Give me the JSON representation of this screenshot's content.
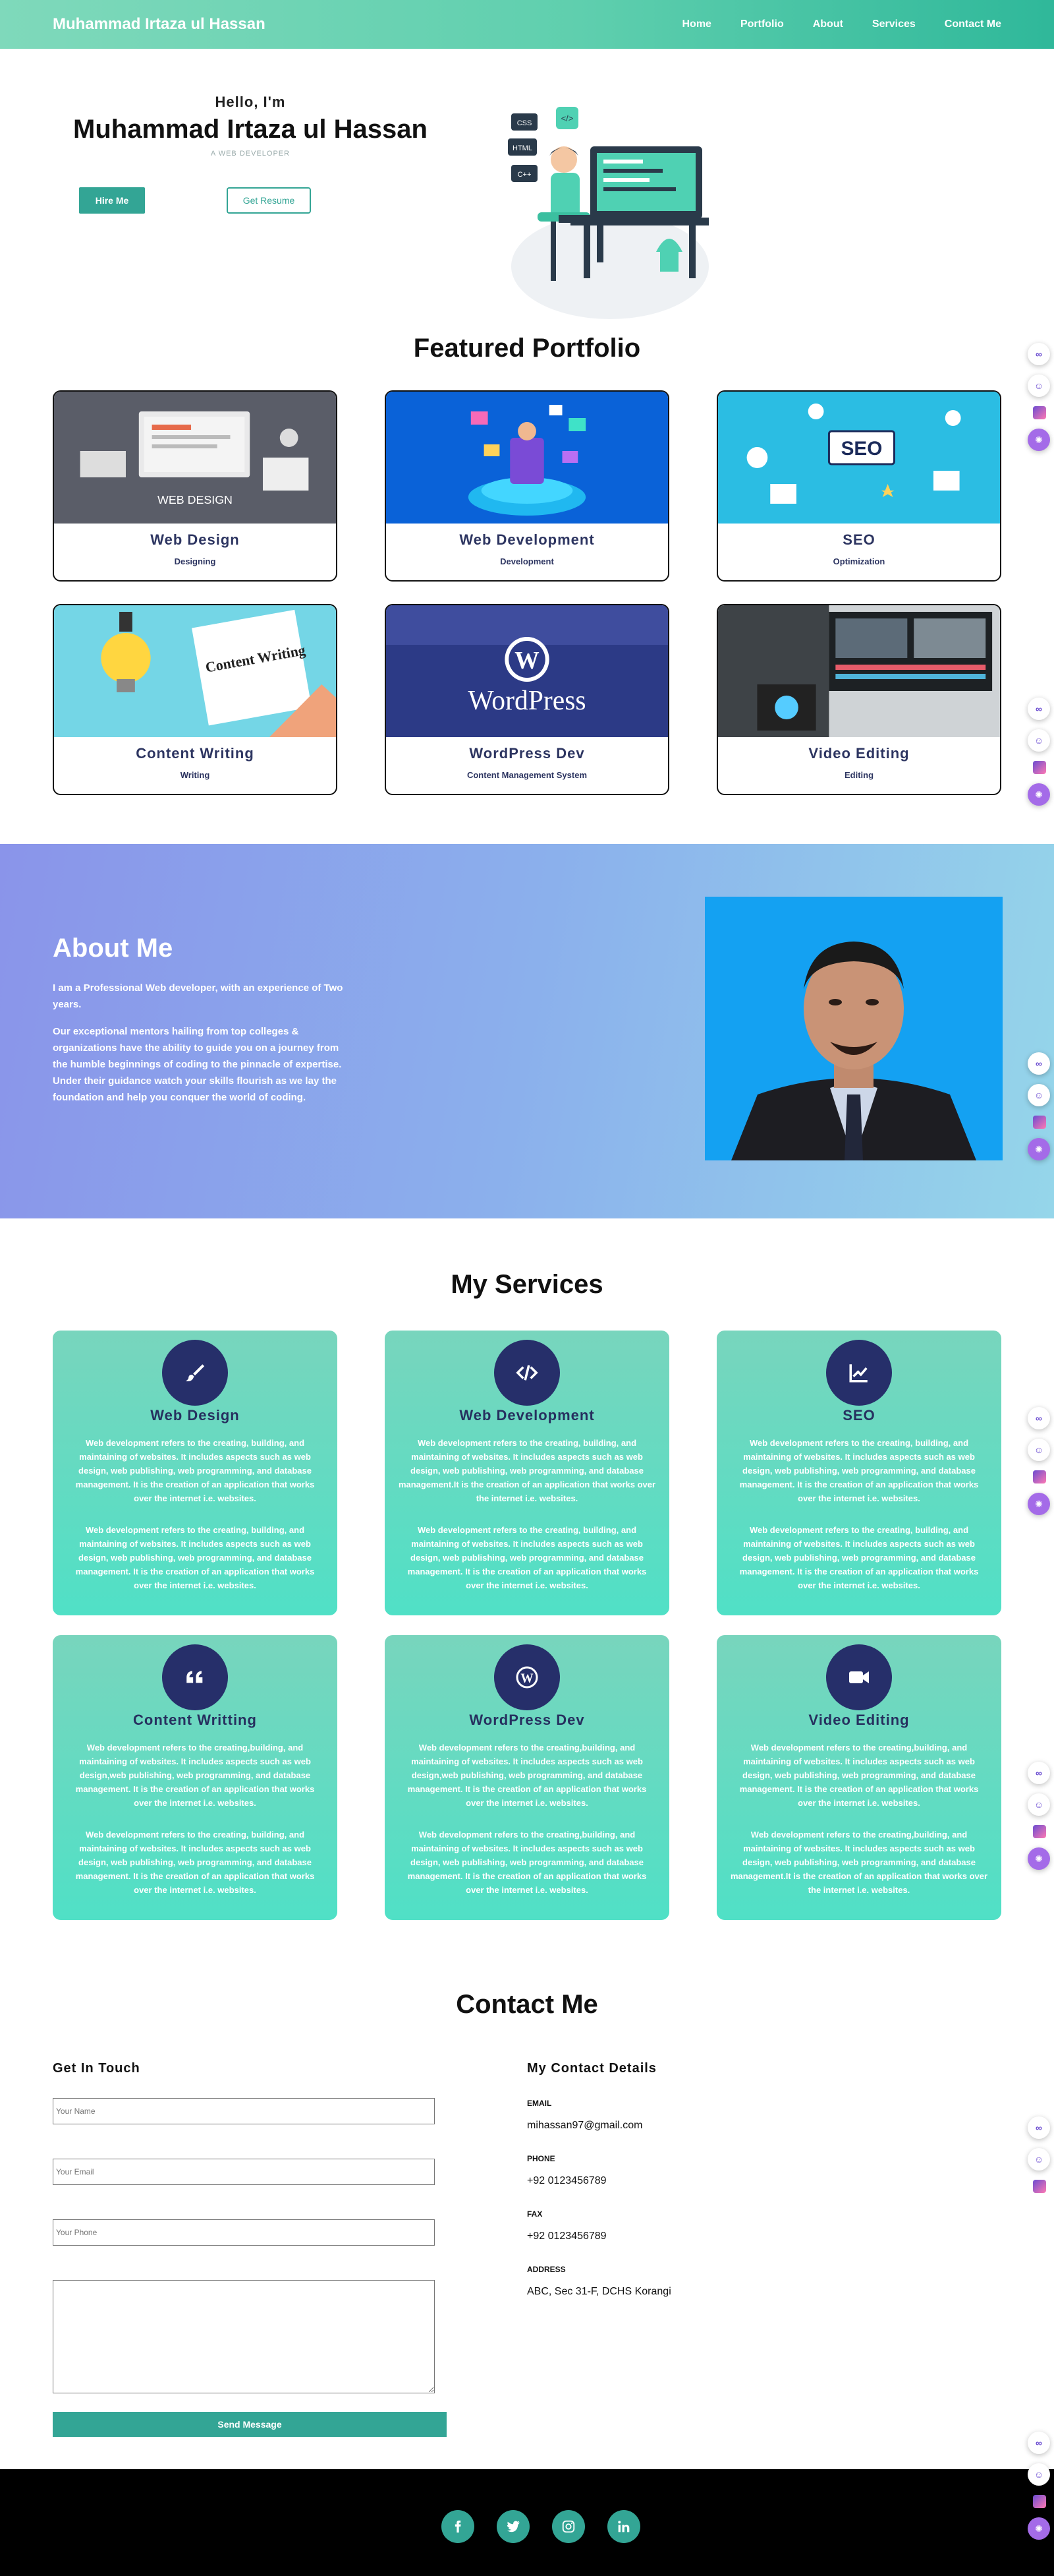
{
  "nav": {
    "brand": "Muhammad Irtaza ul Hassan",
    "links": [
      "Home",
      "Portfolio",
      "About",
      "Services",
      "Contact Me"
    ]
  },
  "hero": {
    "greeting": "Hello, I'm",
    "name": "Muhammad Irtaza ul Hassan",
    "role": "A WEB DEVELOPER",
    "hire_label": "Hire Me",
    "resume_label": "Get Resume",
    "illustration_tags": [
      "CSS",
      "HTML",
      "C++"
    ]
  },
  "portfolio": {
    "title": "Featured Portfolio",
    "items": [
      {
        "title": "Web Design",
        "sub": "Designing",
        "image_text": "WEB DESIGN"
      },
      {
        "title": "Web Development",
        "sub": "Development",
        "image_text": ""
      },
      {
        "title": "SEO",
        "sub": "Optimization",
        "image_text": "SEO"
      },
      {
        "title": "Content Writing",
        "sub": "Writing",
        "image_text": "Content Writing"
      },
      {
        "title": "WordPress Dev",
        "sub": "Content Management System",
        "image_text": "WordPress"
      },
      {
        "title": "Video Editing",
        "sub": "Editing",
        "image_text": ""
      }
    ]
  },
  "about": {
    "title": "About Me",
    "p1": "I am a Professional Web developer, with an experience of Two years.",
    "p2": "Our exceptional mentors hailing from top colleges & organizations have the ability to guide you on a journey from the humble beginnings of coding to the pinnacle of expertise. Under their guidance watch your skills flourish as we lay the foundation and help you conquer the world of coding."
  },
  "services": {
    "title": "My Services",
    "items": [
      {
        "title": "Web Design",
        "icon": "brush-icon",
        "a": "Web development refers to the creating, building, and maintaining of websites. It includes aspects such as web design, web publishing, web programming, and database management. It is the creation of an application that works over the internet i.e. websites.",
        "b": "Web development refers to the creating, building, and maintaining of websites. It includes aspects such as web design, web publishing, web programming, and database management. It is the creation of an application that works over the internet i.e. websites."
      },
      {
        "title": "Web Development",
        "icon": "code-icon",
        "a": "Web development refers to the creating, building, and maintaining of websites. It includes aspects such as web design, web publishing, web programming, and database management.It is the creation of an application that works over the internet i.e. websites.",
        "b": "Web development refers to the creating, building, and maintaining of websites. It includes aspects such as web design, web publishing, web programming, and database management. It is the creation of an application that works over the internet i.e. websites."
      },
      {
        "title": "SEO",
        "icon": "chart-line-icon",
        "a": "Web development refers to the creating, building, and maintaining of websites. It includes aspects such as web design, web publishing, web programming, and database management. It is the creation of an application that works over the internet i.e. websites.",
        "b": "Web development refers to the creating, building, and maintaining of websites. It includes aspects such as web design, web publishing, web programming, and database management. It is the creation of an application that works over the internet i.e. websites."
      },
      {
        "title": "Content Writting",
        "icon": "quote-icon",
        "a": "Web development refers to the creating,building, and maintaining of websites. It includes aspects such as web design,web publishing, web programming, and database management. It is the creation of an application that works over the internet i.e. websites.",
        "b": "Web development refers to the creating, building, and maintaining of websites. It includes aspects such as web design, web publishing, web programming, and database management. It is the creation of an application that works over the internet i.e. websites."
      },
      {
        "title": "WordPress Dev",
        "icon": "wordpress-icon",
        "a": "Web development refers to the creating,building, and maintaining of websites. It includes aspects such as web design,web publishing, web programming, and database management. It is the creation of an application that works over the internet i.e. websites.",
        "b": "Web development refers to the creating,building, and maintaining of websites. It includes aspects such as web design, web publishing, web programming, and database management. It is the creation of an application that works over the internet i.e. websites."
      },
      {
        "title": "Video Editing",
        "icon": "video-icon",
        "a": "Web development refers to the creating,building, and maintaining of websites. It includes aspects such as web design, web publishing, web programming, and database management. It is the creation of an application that works over the internet i.e. websites.",
        "b": "Web development refers to the creating,building, and maintaining of websites. It includes aspects such as web design, web publishing, web programming, and database management.It is the creation of an application that works over the internet i.e. websites."
      }
    ]
  },
  "contact": {
    "title": "Contact Me",
    "form_heading": "Get In Touch",
    "name_placeholder": "Your Name",
    "email_placeholder": "Your Email",
    "phone_placeholder": "Your Phone",
    "send_label": "Send Message",
    "details_heading": "My Contact Details",
    "email_label": "EMAIL",
    "email_value": "mihassan97@gmail.com",
    "phone_label": "PHONE",
    "phone_value": "+92 0123456789",
    "fax_label": "FAX",
    "fax_value": "+92 0123456789",
    "address_label": "ADDRESS",
    "address_value": "ABC, Sec 31-F, DCHS Korangi"
  },
  "footer": {
    "social": [
      "f",
      "t",
      "ig",
      "in"
    ]
  },
  "colors": {
    "accent": "#33a595",
    "navy": "#26305f",
    "service_top": "#78d5bd",
    "service_bottom": "#50e0c6"
  }
}
